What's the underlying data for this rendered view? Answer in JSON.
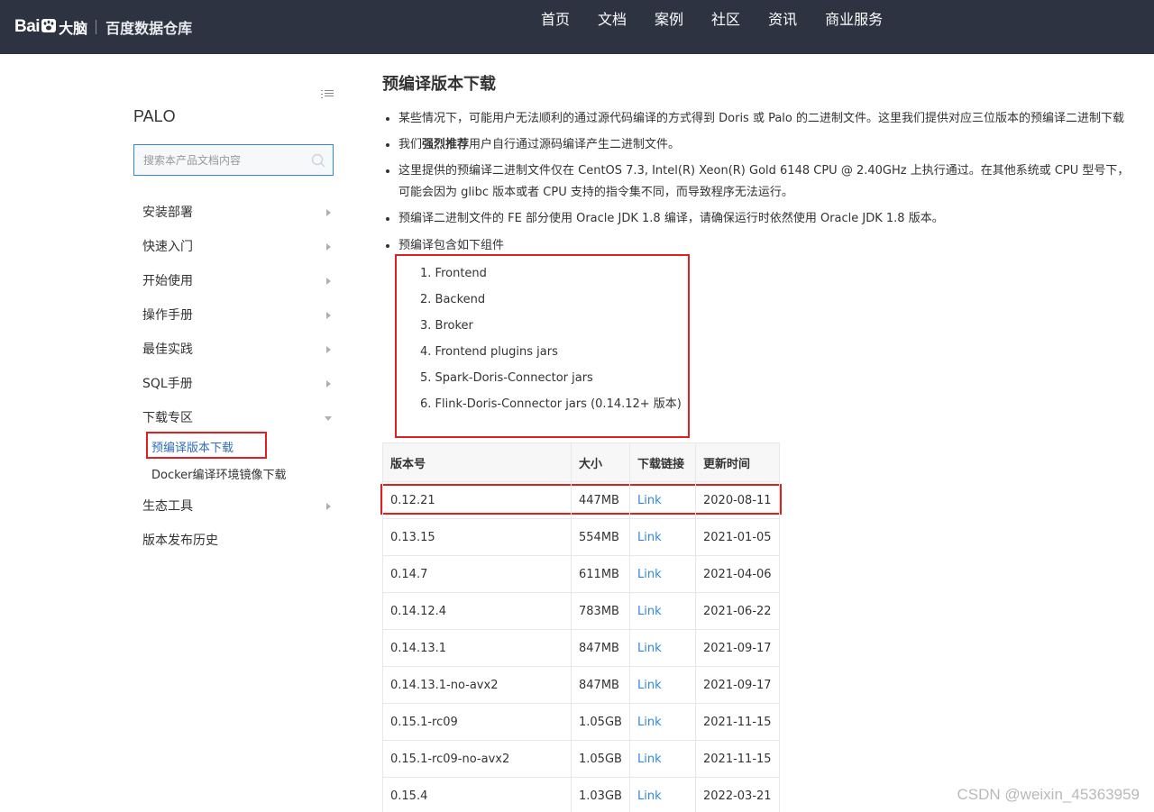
{
  "header": {
    "logo_text_bai": "Bai",
    "logo_text_dn": "大脑",
    "product": "百度数据仓库",
    "nav": [
      "首页",
      "文档",
      "案例",
      "社区",
      "资讯",
      "商业服务"
    ]
  },
  "sidebar": {
    "title": "PALO",
    "search_placeholder": "搜索本产品文档内容",
    "items": [
      {
        "label": "安装部署"
      },
      {
        "label": "快速入门"
      },
      {
        "label": "开始使用"
      },
      {
        "label": "操作手册"
      },
      {
        "label": "最佳实践"
      },
      {
        "label": "SQL手册"
      },
      {
        "label": "下载专区",
        "expanded": true
      },
      {
        "label": "生态工具"
      },
      {
        "label": "版本发布历史"
      }
    ],
    "subitems": [
      {
        "label": "预编译版本下载",
        "active": true
      },
      {
        "label": "Docker编译环境镜像下载"
      }
    ]
  },
  "main": {
    "title": "预编译版本下载",
    "bullets": [
      "某些情况下，可能用户无法顺利的通过源代码编译的方式得到 Doris 或 Palo 的二进制文件。这里我们提供对应三位版本的预编译二进制下载",
      "我们",
      "强烈推荐",
      "用户自行通过源码编译产生二进制文件。",
      "这里提供的预编译二进制文件仅在 CentOS 7.3, Intel(R) Xeon(R) Gold 6148 CPU @ 2.40GHz 上执行通过。在其他系统或 CPU 型号下，可能会因为 glibc 版本或者 CPU 支持的指令集不同，而导致程序无法运行。",
      "预编译二进制文件的 FE 部分使用 Oracle JDK 1.8 编译，请确保运行时依然使用 Oracle JDK 1.8 版本。",
      "预编译包含如下组件"
    ],
    "components": [
      "1. Frontend",
      "2. Backend",
      "3. Broker",
      "4. Frontend plugins jars",
      "5. Spark-Doris-Connector jars",
      "6. Flink-Doris-Connector jars (0.14.12+ 版本)"
    ],
    "table": {
      "headers": [
        "版本号",
        "大小",
        "下载链接",
        "更新时间"
      ],
      "rows": [
        [
          "0.12.21",
          "447MB",
          "Link",
          "2020-08-11"
        ],
        [
          "0.13.15",
          "554MB",
          "Link",
          "2021-01-05"
        ],
        [
          "0.14.7",
          "611MB",
          "Link",
          "2021-04-06"
        ],
        [
          "0.14.12.4",
          "783MB",
          "Link",
          "2021-06-22"
        ],
        [
          "0.14.13.1",
          "847MB",
          "Link",
          "2021-09-17"
        ],
        [
          "0.14.13.1-no-avx2",
          "847MB",
          "Link",
          "2021-09-17"
        ],
        [
          "0.15.1-rc09",
          "1.05GB",
          "Link",
          "2021-11-15"
        ],
        [
          "0.15.1-rc09-no-avx2",
          "1.05GB",
          "Link",
          "2021-11-15"
        ],
        [
          "0.15.4",
          "1.03GB",
          "Link",
          "2022-03-21"
        ]
      ]
    }
  },
  "watermark": "CSDN @weixin_45363959",
  "colors": {
    "header_bg": "#2d3340",
    "accent": "#2f89e0",
    "highlight_box": "#e02020"
  }
}
